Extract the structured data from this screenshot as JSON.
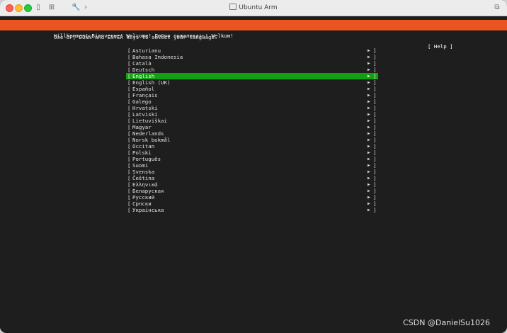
{
  "window": {
    "title": "Ubuntu Arm"
  },
  "icons": {
    "sidebar": "▯",
    "settings": "⊞",
    "wrench": "🔧",
    "chevron": "›",
    "copy": "⧉"
  },
  "banner": {
    "text": "Willkommen! Bienvenue! Welcome! Добро пожаловать! Welkom!",
    "help_label": "[ Help ]"
  },
  "instruction": "Use UP, DOWN and ENTER keys to select your language.",
  "languages": {
    "selected": "English",
    "items": [
      {
        "label": "Asturianu"
      },
      {
        "label": "Bahasa Indonesia"
      },
      {
        "label": "Català"
      },
      {
        "label": "Deutsch"
      },
      {
        "label": "English"
      },
      {
        "label": "English (UK)"
      },
      {
        "label": "Español"
      },
      {
        "label": "Français"
      },
      {
        "label": "Galego"
      },
      {
        "label": "Hrvatski"
      },
      {
        "label": "Latviski"
      },
      {
        "label": "Lietuviškai"
      },
      {
        "label": "Magyar"
      },
      {
        "label": "Nederlands"
      },
      {
        "label": "Norsk bokmål"
      },
      {
        "label": "Occitan"
      },
      {
        "label": "Polski"
      },
      {
        "label": "Português"
      },
      {
        "label": "Suomi"
      },
      {
        "label": "Svenska"
      },
      {
        "label": "Čeština"
      },
      {
        "label": "Ελληνικά"
      },
      {
        "label": "Беларуская"
      },
      {
        "label": "Русский"
      },
      {
        "label": "Српски"
      },
      {
        "label": "Українська"
      }
    ]
  },
  "watermark": "CSDN @DanielSu1026",
  "colors": {
    "banner": "#e95420",
    "selection": "#11a011",
    "console_bg": "#1e1e1e"
  }
}
